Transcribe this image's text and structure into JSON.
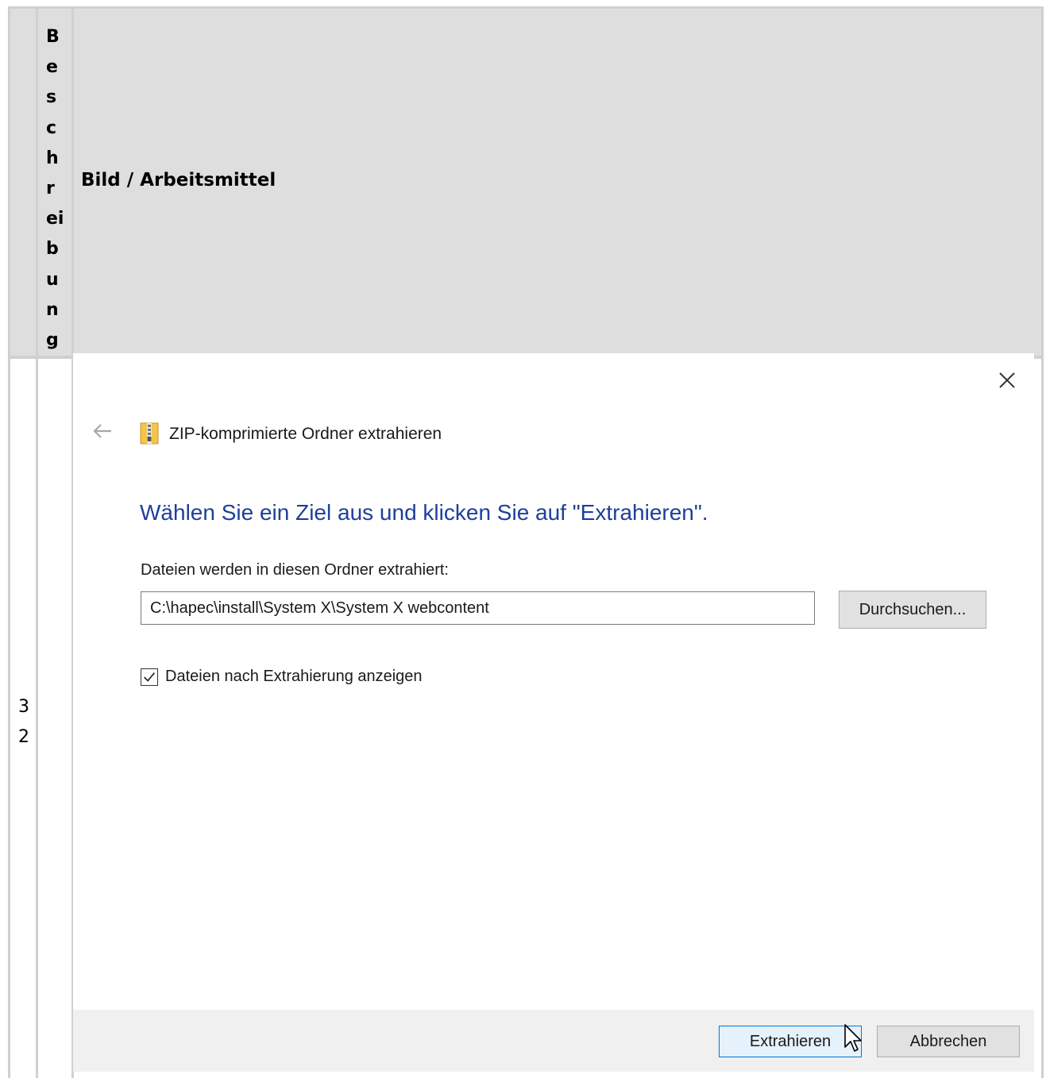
{
  "table": {
    "header_stack": [
      "B",
      "e",
      "s",
      "c",
      "h",
      "r",
      "ei",
      "b",
      "u",
      "n",
      "g"
    ],
    "header_title": "Bild / Arbeitsmittel",
    "row_number": [
      "3",
      "2"
    ]
  },
  "dialog": {
    "title": "ZIP-komprimierte Ordner extrahieren",
    "heading": "Wählen Sie ein Ziel aus und klicken Sie auf \"Extrahieren\".",
    "field_label": "Dateien werden in diesen Ordner extrahiert:",
    "path_value": "C:\\hapec\\install\\System X\\System X webcontent",
    "browse_label": "Durchsuchen...",
    "checkbox_label": "Dateien nach Extrahierung anzeigen",
    "checkbox_checked": true,
    "extract_label": "Extrahieren",
    "cancel_label": "Abbrechen",
    "icons": {
      "close": "close-icon",
      "back": "back-arrow-icon",
      "zip": "zip-folder-icon",
      "cursor": "mouse-pointer-icon"
    },
    "colors": {
      "heading": "#1e3f9c",
      "primary_border": "#0078d7",
      "footer": "#f0f0f0"
    }
  }
}
